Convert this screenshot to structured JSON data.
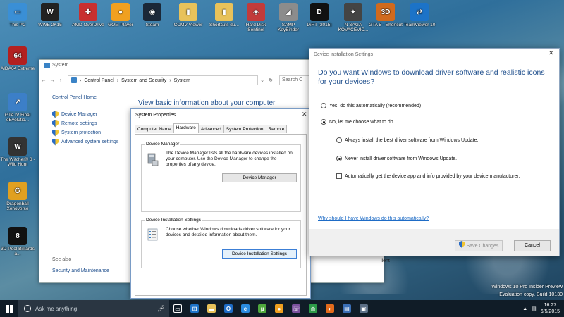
{
  "desktop": {
    "icons": [
      {
        "label": "This PC",
        "icon": "computer-icon",
        "color": "#3a8fd6",
        "glyph": "▭"
      },
      {
        "label": "WWE 2K15",
        "icon": "wwe-icon",
        "color": "#222222",
        "glyph": "W"
      },
      {
        "label": "AMD OverDrive",
        "icon": "amd-overdrive-icon",
        "color": "#c83030",
        "glyph": "✚"
      },
      {
        "label": "GOM Player",
        "icon": "gom-player-icon",
        "color": "#f0a020",
        "glyph": "●"
      },
      {
        "label": "Steam",
        "icon": "steam-icon",
        "color": "#1b2838",
        "glyph": "◉"
      },
      {
        "label": "CCMV Viewer",
        "icon": "folder-icon",
        "color": "#e8c25a",
        "glyph": "▮"
      },
      {
        "label": "Shortcuts du...",
        "icon": "folder-icon",
        "color": "#e8c25a",
        "glyph": "▮"
      },
      {
        "label": "Hard Disk Sentinel",
        "icon": "hard-disk-sentinel-icon",
        "color": "#c23b3b",
        "glyph": "◈"
      },
      {
        "label": "SAMP KeyBinder",
        "icon": "samp-keybinder-icon",
        "color": "#8c8c8c",
        "glyph": "◢"
      },
      {
        "label": "DiRT (2015)",
        "icon": "dirt-icon",
        "color": "#111111",
        "glyph": "D"
      },
      {
        "label": "N SAGA KOVACEVIC...",
        "icon": "nsaga-icon",
        "color": "#444444",
        "glyph": "✦"
      },
      {
        "label": "GTA 5 - Shortcut",
        "icon": "3dm-icon",
        "color": "#d06a1e",
        "glyph": "3D"
      },
      {
        "label": "TeamViewer 10",
        "icon": "teamviewer-icon",
        "color": "#1c73c8",
        "glyph": "⇄"
      },
      {
        "label": "AIDA64 Extreme",
        "icon": "aida64-icon",
        "color": "#b32020",
        "glyph": "64"
      },
      {
        "label": "GTA IV Final eEvolutio...",
        "icon": "gta-iv-icon",
        "color": "#3c7fc8",
        "glyph": "↗"
      },
      {
        "label": "The Witcher® 3 - Wild Hunt",
        "icon": "witcher-icon",
        "color": "#333333",
        "glyph": "W"
      },
      {
        "label": "Dragonball Xenoverse",
        "icon": "dragonball-icon",
        "color": "#e0a020",
        "glyph": "✪"
      },
      {
        "label": "3D Pool Billiards a...",
        "icon": "pool-ball-icon",
        "color": "#111111",
        "glyph": "8"
      }
    ]
  },
  "system_window": {
    "title": "System",
    "breadcrumb": [
      "Control Panel",
      "System and Security",
      "System"
    ],
    "search_placeholder": "Search C",
    "left": {
      "home": "Control Panel Home",
      "links": [
        "Device Manager",
        "Remote settings",
        "System protection",
        "Advanced system settings"
      ],
      "see_also": "See also",
      "security": "Security and Maintenance"
    },
    "heading": "View basic information about your computer",
    "client_text": "lient"
  },
  "system_properties": {
    "title": "System Properties",
    "tabs": [
      "Computer Name",
      "Hardware",
      "Advanced",
      "System Protection",
      "Remote"
    ],
    "active_tab": "Hardware",
    "device_manager": {
      "title": "Device Manager",
      "text": "The Device Manager lists all the hardware devices installed on your computer. Use the Device Manager to change the properties of any device.",
      "button": "Device Manager"
    },
    "device_install": {
      "title": "Device Installation Settings",
      "text": "Choose whether Windows downloads driver software for your devices and detailed information about them.",
      "button": "Device Installation Settings"
    }
  },
  "device_installation_settings": {
    "title": "Device Installation Settings",
    "question": "Do you want Windows to download driver software and realistic icons for your devices?",
    "option_yes": "Yes, do this automatically (recommended)",
    "option_no": "No, let me choose what to do",
    "sub_always": "Always install the best driver software from Windows Update.",
    "sub_never": "Never install driver software from Windows Update.",
    "auto_get": "Automatically get the device app and info provided by your device manufacturer.",
    "link": "Why should I have Windows do this automatically?",
    "save_label": "Save Changes",
    "cancel_label": "Cancel",
    "selected_option": "no",
    "selected_sub": "never",
    "auto_get_checked": false
  },
  "watermark": {
    "line1": "Windows 10 Pro Insider Preview",
    "line2": "Evaluation copy. Build 10130"
  },
  "taskbar": {
    "search_placeholder": "Ask me anything",
    "apps": [
      {
        "icon": "task-view-icon",
        "color": "#101c27",
        "glyph": "▭"
      },
      {
        "icon": "store-icon",
        "color": "#1e73c8",
        "glyph": "⊞"
      },
      {
        "icon": "file-explorer-icon",
        "color": "#e8c25a",
        "glyph": "▬"
      },
      {
        "icon": "outlook-icon",
        "color": "#1e6cc6",
        "glyph": "O"
      },
      {
        "icon": "internet-explorer-icon",
        "color": "#2a8be0",
        "glyph": "e"
      },
      {
        "icon": "utorrent-icon",
        "color": "#4fa83d",
        "glyph": "µ"
      },
      {
        "icon": "gom-player-icon",
        "color": "#f0a020",
        "glyph": "●"
      },
      {
        "icon": "viber-icon",
        "color": "#7b519d",
        "glyph": "☏"
      },
      {
        "icon": "chrome-icon",
        "color": "#2c9a48",
        "glyph": "◍"
      },
      {
        "icon": "firefox-icon",
        "color": "#e36b1c",
        "glyph": "◐"
      },
      {
        "icon": "control-panel-icon",
        "color": "#3b6fb6",
        "glyph": "▤"
      },
      {
        "icon": "system-properties-icon",
        "color": "#5c6f86",
        "glyph": "▣"
      }
    ],
    "time": "16:27",
    "date": "6/5/2015"
  }
}
